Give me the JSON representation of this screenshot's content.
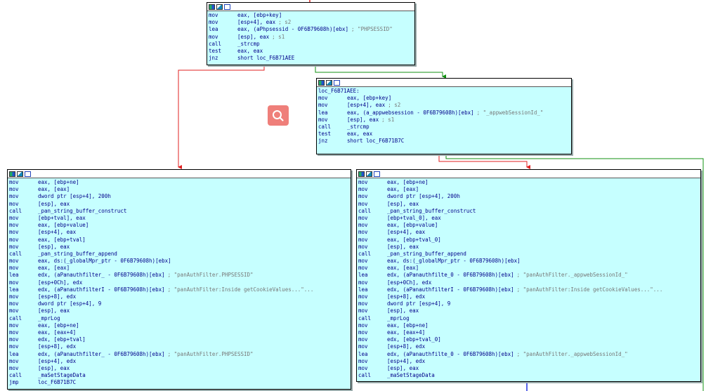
{
  "nodes": [
    {
      "rows": [
        {
          "m": "mov",
          "o": "eax, [ebp+key]"
        },
        {
          "m": "mov",
          "o": "[esp+4], eax",
          "c": "; s2"
        },
        {
          "m": "lea",
          "o": "eax, (aPhpsessid - 0F6B79608h)[ebx]",
          "c": "; \"PHPSESSID\""
        },
        {
          "m": "mov",
          "o": "[esp], eax",
          "c": "; s1"
        },
        {
          "m": "call",
          "o": "_strcmp"
        },
        {
          "m": "test",
          "o": "eax, eax"
        },
        {
          "m": "jnz",
          "o": "short loc_F6B71AEE"
        }
      ]
    },
    {
      "label": "loc_F6B71AEE:",
      "rows": [
        {
          "m": "mov",
          "o": "eax, [ebp+key]"
        },
        {
          "m": "mov",
          "o": "[esp+4], eax",
          "c": "; s2"
        },
        {
          "m": "lea",
          "o": "eax, (a_appwebsession - 0F6B79608h)[ebx]",
          "c": "; \"_appwebSessionId_\""
        },
        {
          "m": "mov",
          "o": "[esp], eax",
          "c": "; s1"
        },
        {
          "m": "call",
          "o": "_strcmp"
        },
        {
          "m": "test",
          "o": "eax, eax"
        },
        {
          "m": "jnz",
          "o": "short loc_F6B71B7C"
        }
      ]
    },
    {
      "rows": [
        {
          "m": "mov",
          "o": "eax, [ebp+ne]"
        },
        {
          "m": "mov",
          "o": "eax, [eax]"
        },
        {
          "m": "mov",
          "o": "dword ptr [esp+4], 200h"
        },
        {
          "m": "mov",
          "o": "[esp], eax"
        },
        {
          "m": "call",
          "o": "_pan_string_buffer_construct"
        },
        {
          "m": "mov",
          "o": "[ebp+tval], eax"
        },
        {
          "m": "mov",
          "o": "eax, [ebp+value]"
        },
        {
          "m": "mov",
          "o": "[esp+4], eax"
        },
        {
          "m": "mov",
          "o": "eax, [ebp+tval]"
        },
        {
          "m": "mov",
          "o": "[esp], eax"
        },
        {
          "m": "call",
          "o": "_pan_string_buffer_append"
        },
        {
          "m": "mov",
          "o": "eax, ds:(_globalMpr_ptr - 0F6B79608h)[ebx]"
        },
        {
          "m": "mov",
          "o": "eax, [eax]"
        },
        {
          "m": "lea",
          "o": "edx, (aPanauthfilter_ - 0F6B79608h)[ebx]",
          "c": "; \"panAuthFilter.PHPSESSID\""
        },
        {
          "m": "mov",
          "o": "[esp+0Ch], edx"
        },
        {
          "m": "lea",
          "o": "edx, (aPanauthfilterI - 0F6B79608h)[ebx]",
          "c": "; \"panAuthFilter:Inside getCookieValues...\"..."
        },
        {
          "m": "mov",
          "o": "[esp+8], edx"
        },
        {
          "m": "mov",
          "o": "dword ptr [esp+4], 9"
        },
        {
          "m": "mov",
          "o": "[esp], eax"
        },
        {
          "m": "call",
          "o": "_mprLog"
        },
        {
          "m": "mov",
          "o": "eax, [ebp+ne]"
        },
        {
          "m": "mov",
          "o": "eax, [eax+4]"
        },
        {
          "m": "mov",
          "o": "edx, [ebp+tval]"
        },
        {
          "m": "mov",
          "o": "[esp+8], edx"
        },
        {
          "m": "lea",
          "o": "edx, (aPanauthfilter_ - 0F6B79608h)[ebx]",
          "c": "; \"panAuthFilter.PHPSESSID\""
        },
        {
          "m": "mov",
          "o": "[esp+4], edx"
        },
        {
          "m": "mov",
          "o": "[esp], eax"
        },
        {
          "m": "call",
          "o": "_maSetStageData"
        },
        {
          "m": "jmp",
          "o": "loc_F6B71B7C"
        }
      ]
    },
    {
      "rows": [
        {
          "m": "mov",
          "o": "eax, [ebp+ne]"
        },
        {
          "m": "mov",
          "o": "eax, [eax]"
        },
        {
          "m": "mov",
          "o": "dword ptr [esp+4], 200h"
        },
        {
          "m": "mov",
          "o": "[esp], eax"
        },
        {
          "m": "call",
          "o": "_pan_string_buffer_construct"
        },
        {
          "m": "mov",
          "o": "[ebp+tval_0], eax"
        },
        {
          "m": "mov",
          "o": "eax, [ebp+value]"
        },
        {
          "m": "mov",
          "o": "[esp+4], eax"
        },
        {
          "m": "mov",
          "o": "eax, [ebp+tval_0]"
        },
        {
          "m": "mov",
          "o": "[esp], eax"
        },
        {
          "m": "call",
          "o": "_pan_string_buffer_append"
        },
        {
          "m": "mov",
          "o": "eax, ds:(_globalMpr_ptr - 0F6B79608h)[ebx]"
        },
        {
          "m": "mov",
          "o": "eax, [eax]"
        },
        {
          "m": "lea",
          "o": "edx, (aPanauthfilte_0 - 0F6B79608h)[ebx]",
          "c": "; \"panAuthFilter._appwebSessionId_\""
        },
        {
          "m": "mov",
          "o": "[esp+0Ch], edx"
        },
        {
          "m": "lea",
          "o": "edx, (aPanauthfilterI - 0F6B79608h)[ebx]",
          "c": "; \"panAuthFilter:Inside getCookieValues...\"..."
        },
        {
          "m": "mov",
          "o": "[esp+8], edx"
        },
        {
          "m": "mov",
          "o": "dword ptr [esp+4], 9"
        },
        {
          "m": "mov",
          "o": "[esp], eax"
        },
        {
          "m": "call",
          "o": "_mprLog"
        },
        {
          "m": "mov",
          "o": "eax, [ebp+ne]"
        },
        {
          "m": "mov",
          "o": "eax, [eax+4]"
        },
        {
          "m": "mov",
          "o": "edx, [ebp+tval_0]"
        },
        {
          "m": "mov",
          "o": "[esp+8], edx"
        },
        {
          "m": "lea",
          "o": "edx, (aPanauthfilte_0 - 0F6B79608h)[ebx]",
          "c": "; \"panAuthFilter._appwebSessionId_\""
        },
        {
          "m": "mov",
          "o": "[esp+4], edx"
        },
        {
          "m": "mov",
          "o": "[esp], eax"
        },
        {
          "m": "call",
          "o": "_maSetStageData"
        }
      ]
    }
  ],
  "colors": {
    "node_bg": "#c6ffff",
    "edge_true": "#e02020",
    "edge_false": "#109010",
    "edge_uncond": "#2030e0",
    "search_btn": "#ef7f7a"
  },
  "icons": [
    "graph-color-icon",
    "graph-edit-icon",
    "graph-view-icon",
    "search-icon"
  ]
}
